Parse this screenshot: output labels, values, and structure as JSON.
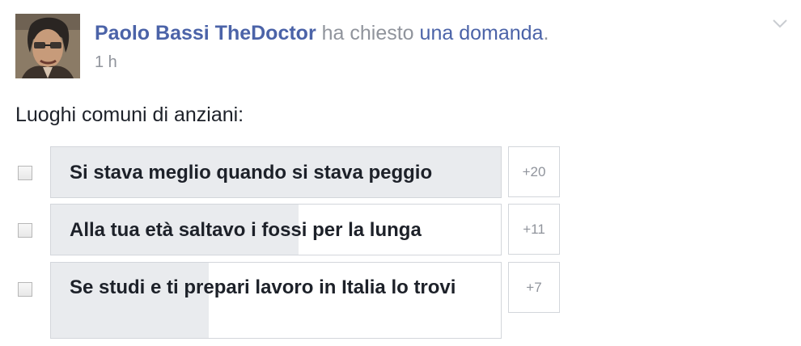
{
  "post": {
    "author": "Paolo Bassi TheDoctor",
    "action_text": "ha chiesto",
    "object_link": "una domanda",
    "punctuation": ".",
    "timestamp": "1 h",
    "question": "Luoghi comuni di anziani:"
  },
  "poll": {
    "options": [
      {
        "label": "Si stava meglio quando si stava peggio",
        "votes": "+20",
        "vote_fill_fraction": 1.0
      },
      {
        "label": "Alla tua età saltavo i fossi per la lunga",
        "votes": "+11",
        "vote_fill_fraction": 0.55
      },
      {
        "label": "Se studi e ti prepari lavoro in Italia lo trovi",
        "votes": "+7",
        "vote_fill_fraction": 0.35
      }
    ]
  },
  "colors": {
    "link": "#4b63a8",
    "muted": "#90949c",
    "text": "#1d2129",
    "poll_fill": "#e9ebee",
    "border": "#d3d6db"
  },
  "icons": {
    "avatar": "profile-photo",
    "chevron": "chevron-down-icon",
    "checkbox": "checkbox-unchecked"
  }
}
